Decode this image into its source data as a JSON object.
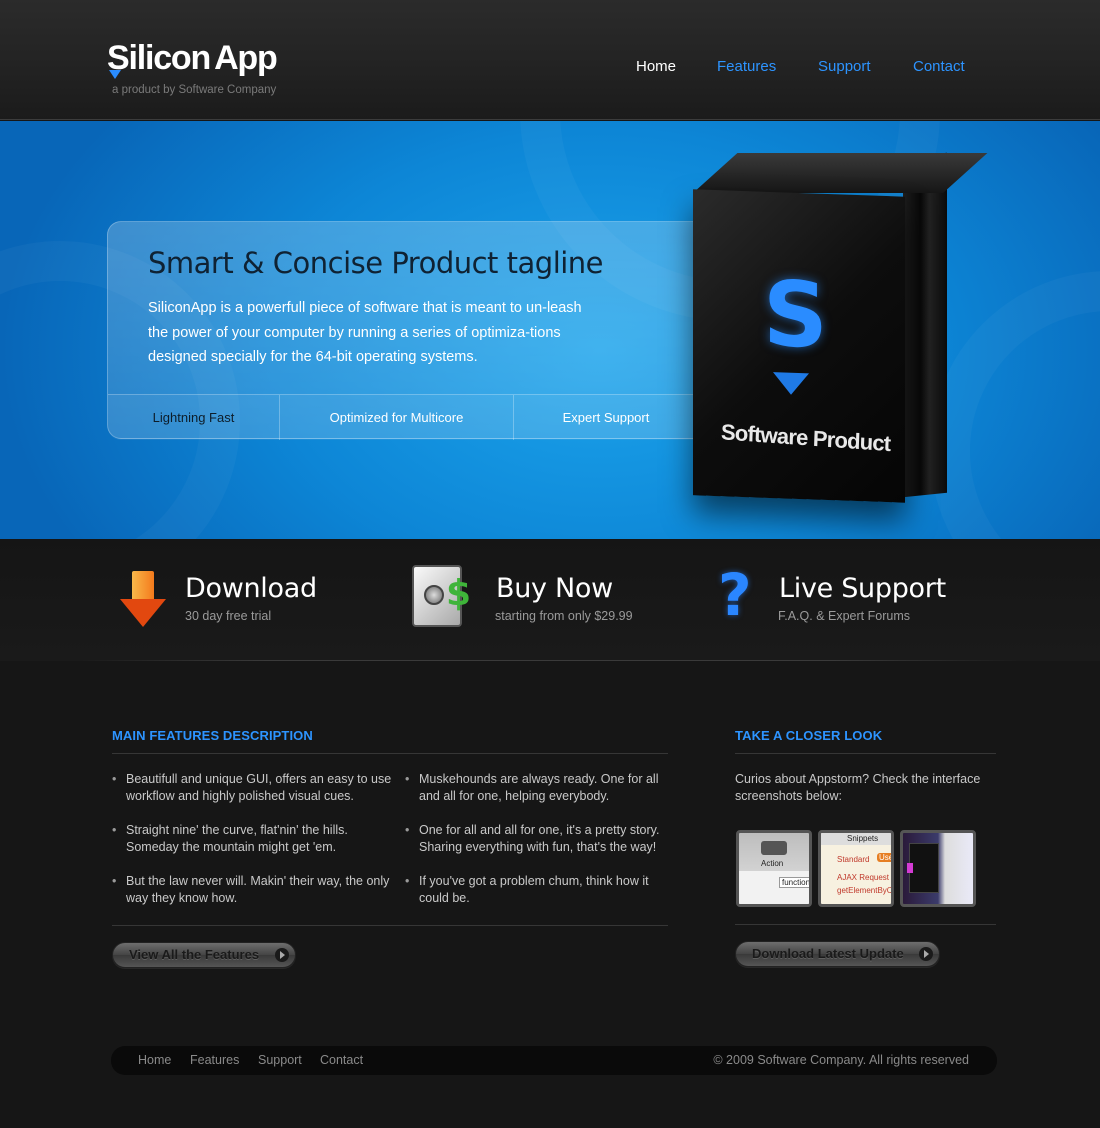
{
  "header": {
    "logo_part1": "Silicon",
    "logo_part2": "App",
    "logo_subtitle": "a product by Software Company",
    "nav": [
      {
        "label": "Home",
        "active": true
      },
      {
        "label": "Features",
        "active": false
      },
      {
        "label": "Support",
        "active": false
      },
      {
        "label": "Contact",
        "active": false
      }
    ]
  },
  "hero": {
    "tagline": "Smart & Concise Product tagline",
    "description": "SiliconApp is a powerfull piece of software that is meant to un-leash the power of your computer by running a series of optimiza-tions designed specially for the 64-bit operating systems.",
    "features": [
      "Lightning Fast",
      "Optimized for Multicore",
      "Expert Support"
    ],
    "box": {
      "letter": "S",
      "label": "Software Product"
    }
  },
  "actions": [
    {
      "title": "Download",
      "subtitle": "30 day free trial",
      "icon": "download-arrow-icon"
    },
    {
      "title": "Buy Now",
      "subtitle": "starting from only $29.99",
      "icon": "safe-dollar-icon"
    },
    {
      "title": "Live Support",
      "subtitle": "F.A.Q. & Expert Forums",
      "icon": "question-mark-icon"
    }
  ],
  "main_features": {
    "title": "MAIN FEATURES DESCRIPTION",
    "items": [
      "Beautifull and unique GUI, offers an easy to use workflow and highly polished visual cues.",
      "Muskehounds are always ready. One for all and all for one, helping everybody.",
      "Straight nine' the curve, flat'nin' the hills. Someday the mountain might get 'em.",
      "One for all and all for one, it's a pretty story. Sharing everything with fun, that's the way!",
      "But the law never will. Makin' their way, the only way they know how.",
      "If you've got a problem chum, think how it could be."
    ],
    "button_label": "View All the Features"
  },
  "closer_look": {
    "title": "TAKE A CLOSER LOOK",
    "text": "Curios about Appstorm? Check the interface screenshots below:",
    "thumbs": [
      {
        "lines": [
          "Action",
          "function"
        ]
      },
      {
        "lines": [
          "Snippets",
          "Standard",
          "Use",
          "AJAX Request",
          "getElementByClas"
        ]
      },
      {
        "lines": []
      }
    ],
    "button_label": "Download Latest Update"
  },
  "footer": {
    "links": [
      "Home",
      "Features",
      "Support",
      "Contact"
    ],
    "copyright": "© 2009 Software Company. All rights reserved"
  },
  "colors": {
    "accent": "#2d94ff",
    "hero_blue": "#0d86d6",
    "background": "#161616"
  }
}
